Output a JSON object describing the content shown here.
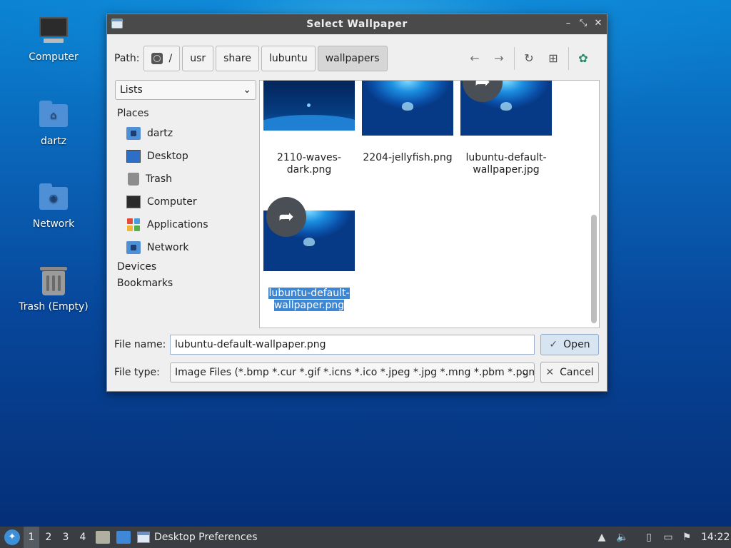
{
  "desktop": {
    "icons": [
      {
        "label": "Computer",
        "icon": "computer-icon"
      },
      {
        "label": "dartz",
        "icon": "home-folder-icon"
      },
      {
        "label": "Network",
        "icon": "network-folder-icon"
      },
      {
        "label": "Trash (Empty)",
        "icon": "trash-icon"
      }
    ]
  },
  "dialog": {
    "title": "Select Wallpaper",
    "path_label": "Path:",
    "breadcrumbs": [
      "/",
      "usr",
      "share",
      "lubuntu",
      "wallpapers"
    ],
    "view_mode": "Lists",
    "sidebar": {
      "places_header": "Places",
      "places": [
        "dartz",
        "Desktop",
        "Trash",
        "Computer",
        "Applications",
        "Network"
      ],
      "devices_header": "Devices",
      "bookmarks_header": "Bookmarks"
    },
    "files": [
      {
        "name_line1": "2110-waves-",
        "name_line2": "dark.png",
        "selected": false
      },
      {
        "name_line1": "2204-jellyfish.png",
        "name_line2": "",
        "selected": false
      },
      {
        "name_line1": "lubuntu-default-",
        "name_line2": "wallpaper.jpg",
        "selected": false
      },
      {
        "name_line1": "lubuntu-default-",
        "name_line2": "wallpaper.png",
        "selected": true
      }
    ],
    "file_name_label": "File name:",
    "file_name_value": "lubuntu-default-wallpaper.png",
    "file_type_label": "File type:",
    "file_type_value": "Image Files (*.bmp *.cur *.gif *.icns *.ico *.jpeg *.jpg *.mng *.pbm *.pgm",
    "open_label": "Open",
    "cancel_label": "Cancel",
    "selection_color": "#3d86d4"
  },
  "taskbar": {
    "desktops": [
      "1",
      "2",
      "3",
      "4"
    ],
    "active_desktop": "1",
    "task_title": "Desktop Preferences",
    "clock": "14:22"
  }
}
